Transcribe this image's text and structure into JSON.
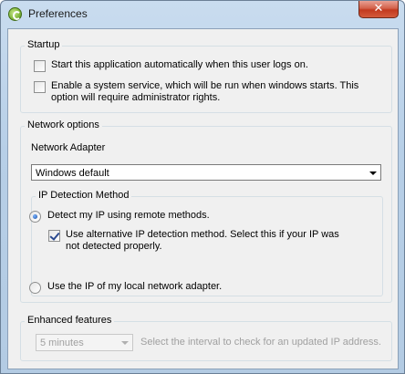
{
  "window": {
    "title": "Preferences",
    "close_glyph": "✕"
  },
  "startup": {
    "legend": "Startup",
    "auto_start": {
      "label": "Start this application automatically when this user logs on.",
      "checked": false
    },
    "system_service": {
      "label_line1": "Enable a system service, which will be run when windows starts. This",
      "label_line2": "option will require administrator rights.",
      "checked": false
    }
  },
  "network": {
    "legend": "Network options",
    "adapter_label": "Network Adapter",
    "adapter_value": "Windows default",
    "ip_detection": {
      "legend": "IP Detection Method",
      "remote": {
        "label": "Detect my IP using remote methods.",
        "selected": true
      },
      "alternative": {
        "label_line1": "Use alternative IP detection method. Select this if your IP was",
        "label_line2": "not detected properly.",
        "checked": true
      },
      "local": {
        "label": "Use the IP of my local network adapter.",
        "selected": false
      }
    }
  },
  "enhanced": {
    "legend": "Enhanced features",
    "interval_value": "5 minutes",
    "interval_description": "Select the interval to check for an updated IP address."
  }
}
